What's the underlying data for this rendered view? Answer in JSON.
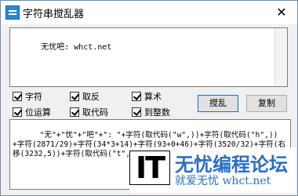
{
  "window": {
    "title": "字符串搅乱器",
    "close_symbol": "✕"
  },
  "input_text": "无忧吧: whct.net",
  "options": [
    {
      "label": "字符",
      "checked": true
    },
    {
      "label": "取反",
      "checked": true
    },
    {
      "label": "算术",
      "checked": true
    },
    {
      "label": "位运算",
      "checked": true
    },
    {
      "label": "取代码",
      "checked": true
    },
    {
      "label": "到整数",
      "checked": true
    }
  ],
  "buttons": {
    "scramble": "搅乱",
    "copy": "复制"
  },
  "output_text": "\"无\"+\"忧\"+\"吧\"+\": \"+字符(取代码(\"w\",))+字符(取代码(\"h\",))+字符(2871/29)+字符(34*3+14)+字符(93+0+46)+字符(3520/32)+字符(右移(3232,5))+字符(取代码(\"t\",)) '搅乱前字符串[无忧吧: whct.net]",
  "watermark": {
    "logo_mark": "IT",
    "title": "无忧编程论坛",
    "subtitle": "就爱无忧 whct.net"
  }
}
